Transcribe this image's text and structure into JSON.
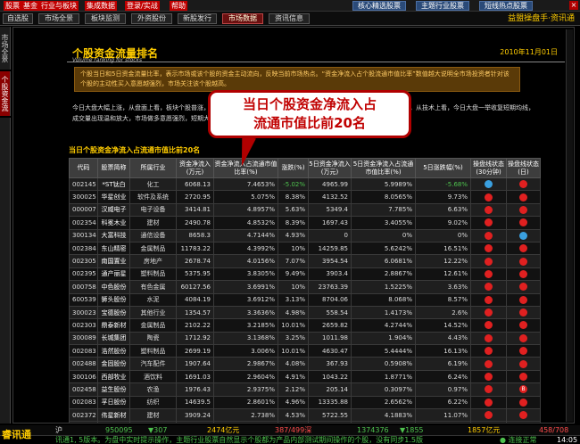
{
  "topmenu": {
    "items": [
      "股票",
      "基金",
      "行业与板块",
      "集成数据",
      "登录/实战",
      "帮助"
    ],
    "right_buttons": [
      "核心精选股票",
      "主题行业股票",
      "短线热点股票"
    ],
    "close": "×"
  },
  "toolbar": {
    "buttons": [
      "自选股",
      "市场全景",
      "板块监测",
      "外资股份",
      "新股发行",
      "市场数据",
      "资讯信息"
    ],
    "active_index": 5,
    "brand": "益盟操盘手·资讯通"
  },
  "left_tabs": [
    "市场全景",
    "个股资金流"
  ],
  "article": {
    "title": "个股资金流量排名",
    "subtitle": "Volume ranking for stocks",
    "date": "2010年11月01日",
    "quote": "个股当日和5日资金流量比率，表示市场或该个股的资金主动流向，反映当前市场热点。“资金净流入占个股流通市值比率”数值越大说明全市场投资者针对该个股的主动性买入意愿越强烈，市场关注该个股越高。",
    "body": "今日大盘大幅上涨，从盘面上看，板块个股普涨，有色金属、煤炭、化工等资源类板块领涨，基建、高速公路板块涨幅较小，从技术上看，今日大盘一举收复短期均线，成交量出现温和放大，市场做多意愿强烈，短期大盘有望继续上攻。板块热点轮动较为明显，短线可适当关注领涨个股。"
  },
  "callout": {
    "line1": "当日个股资金净流入占",
    "line2": "流通市值比前20名"
  },
  "table": {
    "caption": "当日个股资金净流入占流通市值比前20名",
    "headers": [
      "代码",
      "股票简称",
      "所属行业",
      "资金净流入(万元)",
      "资金净流入占流通市值比率(%)",
      "涨跌(%)",
      "5日资金净流入(万元)",
      "5日资金净流入占流通市值比率(%)",
      "5日涨跌幅(%)",
      "操盘线状态(30分钟)",
      "操盘线状态(日)"
    ],
    "rows": [
      [
        "002145",
        "*ST钛白",
        "化工",
        "6068.13",
        "7.4653%",
        "-5.02%",
        "4965.99",
        "5.9989%",
        "-5.68%",
        "blue",
        "red"
      ],
      [
        "300025",
        "华星创业",
        "软件及系统",
        "2720.95",
        "5.075%",
        "8.38%",
        "4132.52",
        "8.0565%",
        "9.73%",
        "red",
        "red"
      ],
      [
        "000007",
        "汉威电子",
        "电子设备",
        "3414.81",
        "4.8957%",
        "5.63%",
        "5349.4",
        "7.785%",
        "6.63%",
        "red",
        "red"
      ],
      [
        "002354",
        "科冕木业",
        "建材",
        "2490.78",
        "4.8532%",
        "8.39%",
        "1697.43",
        "3.4055%",
        "9.02%",
        "red",
        "red"
      ],
      [
        "300134",
        "大富科技",
        "通信设备",
        "8658.3",
        "4.7144%",
        "4.93%",
        "0",
        "0%",
        "0%",
        "red",
        "blue"
      ],
      [
        "002384",
        "东山精密",
        "金属制品",
        "11783.22",
        "4.3992%",
        "10%",
        "14259.85",
        "5.6242%",
        "16.51%",
        "red",
        "red"
      ],
      [
        "002305",
        "南国置业",
        "房地产",
        "2678.74",
        "4.0156%",
        "7.07%",
        "3954.54",
        "6.0681%",
        "12.22%",
        "red",
        "red"
      ],
      [
        "002395",
        "通产丽星",
        "塑料制品",
        "5375.95",
        "3.8305%",
        "9.49%",
        "3903.4",
        "2.8867%",
        "12.61%",
        "red",
        "red"
      ],
      [
        "000758",
        "中色股份",
        "有色金属",
        "60127.56",
        "3.6991%",
        "10%",
        "23763.39",
        "1.5225%",
        "3.63%",
        "red",
        "red"
      ],
      [
        "600539",
        "狮头股份",
        "水泥",
        "4084.19",
        "3.6912%",
        "3.13%",
        "8704.06",
        "8.068%",
        "8.57%",
        "red",
        "red"
      ],
      [
        "300023",
        "宝德股份",
        "其他行业",
        "1354.57",
        "3.3636%",
        "4.98%",
        "558.54",
        "1.4173%",
        "2.6%",
        "red",
        "red"
      ],
      [
        "002303",
        "鼎泰新材",
        "金属制品",
        "2102.22",
        "3.2185%",
        "10.01%",
        "2659.82",
        "4.2744%",
        "14.52%",
        "red",
        "red"
      ],
      [
        "300089",
        "长城集团",
        "陶瓷",
        "1712.92",
        "3.1368%",
        "3.25%",
        "1011.98",
        "1.904%",
        "4.43%",
        "red",
        "red"
      ],
      [
        "002083",
        "浩然股份",
        "塑料制品",
        "2699.19",
        "3.006%",
        "10.01%",
        "4630.47",
        "5.4444%",
        "16.13%",
        "red",
        "red"
      ],
      [
        "002488",
        "金固股份",
        "汽车配件",
        "1907.64",
        "2.9867%",
        "4.08%",
        "367.93",
        "0.5908%",
        "6.19%",
        "red",
        "red"
      ],
      [
        "300106",
        "西部牧业",
        "酒饮料",
        "1691.03",
        "2.9604%",
        "4.91%",
        "1043.22",
        "1.8771%",
        "6.24%",
        "red",
        "red"
      ],
      [
        "002458",
        "益生股份",
        "农渔",
        "1976.43",
        "2.9375%",
        "2.12%",
        "205.14",
        "0.3097%",
        "0.97%",
        "red",
        "B"
      ],
      [
        "002083",
        "孚日股份",
        "纺织",
        "14639.5",
        "2.8601%",
        "4.96%",
        "13335.88",
        "2.6562%",
        "6.22%",
        "red",
        "red"
      ],
      [
        "002372",
        "伟星新材",
        "建材",
        "3909.24",
        "2.738%",
        "4.53%",
        "5722.55",
        "4.1883%",
        "11.07%",
        "red",
        "red"
      ],
      [
        "300108",
        "双龙股份",
        "化工",
        "873.95",
        "2.7269%",
        "5.11%",
        "640.97",
        "2.0865%",
        "8.77%",
        "red",
        "red"
      ]
    ]
  },
  "ticker": {
    "brand": "睿讯通",
    "items": [
      "沪",
      "950095",
      "▼307",
      "2474亿元",
      "387/499深",
      "1374376",
      "▼1855",
      "1857亿元",
      "458/708"
    ]
  },
  "status": {
    "text": "讯通1, 5版本。为盘中实时提示操作，主题行业股票自然显示个股都为产品内部测试期间操作的个股，没有同步1.5版",
    "connection": "● 连接正常",
    "time": "14:05"
  },
  "colors": {
    "accent": "#ffcc00",
    "up": "#ff4c4c",
    "down": "#4ec24e",
    "callout_border": "#b00000"
  }
}
